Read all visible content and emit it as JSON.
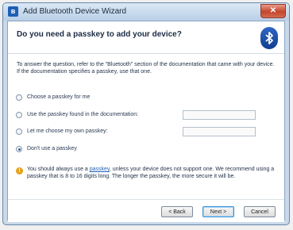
{
  "window": {
    "title": "Add Bluetooth Device Wizard",
    "close_glyph": "✕"
  },
  "header": {
    "heading": "Do you need a passkey to add your device?",
    "logo_icon": "bluetooth-icon"
  },
  "description": "To answer the question, refer to the \"Bluetooth\" section of the documentation that came with your device. If the documentation specifies a passkey, use that one.",
  "options": [
    {
      "label": "Choose a passkey for me",
      "checked": false
    },
    {
      "label": "Use the passkey found in the documentation:",
      "checked": false,
      "field_value": ""
    },
    {
      "label": "Let me choose my own passkey:",
      "checked": false,
      "field_value": ""
    },
    {
      "label": "Don't use a passkey",
      "checked": true
    }
  ],
  "note": {
    "icon": "info-icon",
    "text_before": "You should always use a ",
    "link": "passkey",
    "text_after": ", unless your device does not support one. We recommend using a passkey that is 8 to 16 digits long. The longer the passkey, the more secure it will be."
  },
  "buttons": {
    "back": "< Back",
    "next": "Next >",
    "cancel": "Cancel"
  },
  "colors": {
    "accent": "#1e5fb3",
    "link": "#1f5fb8",
    "info": "#e3a21a"
  }
}
